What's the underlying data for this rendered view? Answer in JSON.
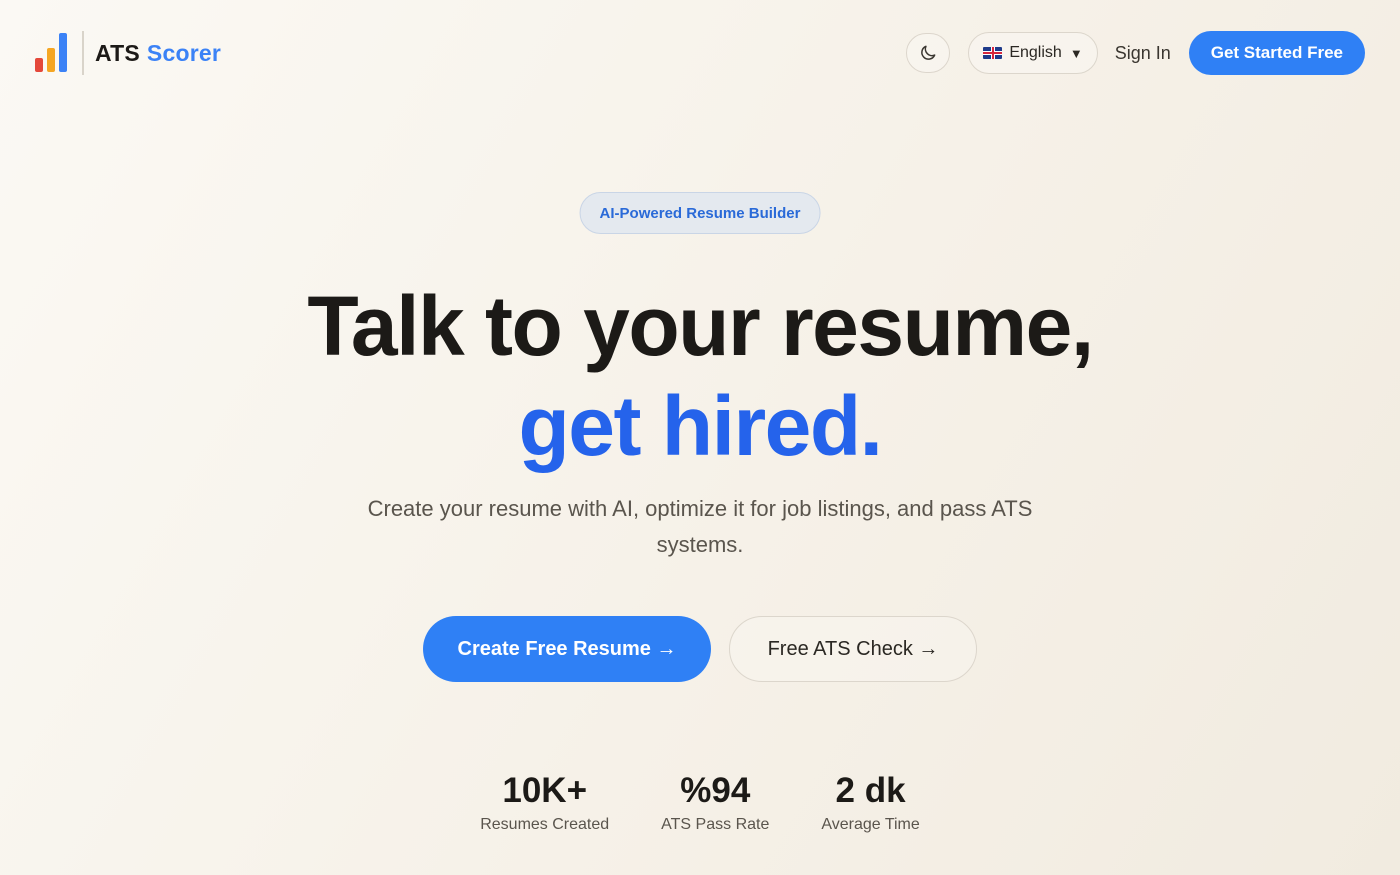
{
  "brand": {
    "name_part1": "ATS",
    "name_part2": "Scorer",
    "colors": {
      "bar1": "#e4483a",
      "bar2": "#f5a623",
      "bar3": "#3b82f6"
    }
  },
  "nav": {
    "theme_icon": "moon-icon",
    "language": "English",
    "language_flag": "uk-flag-icon",
    "sign_in": "Sign In",
    "cta": "Get Started Free"
  },
  "hero": {
    "badge": "AI-Powered Resume Builder",
    "headline_line1": "Talk to your resume,",
    "headline_line2": "get hired.",
    "subtitle": "Create your resume with AI, optimize it for job listings, and pass ATS systems.",
    "primary_button": "Create Free Resume →",
    "secondary_button": "Free ATS Check →"
  },
  "stats": [
    {
      "value": "10K+",
      "label": "Resumes Created"
    },
    {
      "value": "%94",
      "label": "ATS Pass Rate"
    },
    {
      "value": "2 dk",
      "label": "Average Time"
    }
  ],
  "colors": {
    "accent": "#2f80f5",
    "headline_accent": "#2563eb"
  }
}
